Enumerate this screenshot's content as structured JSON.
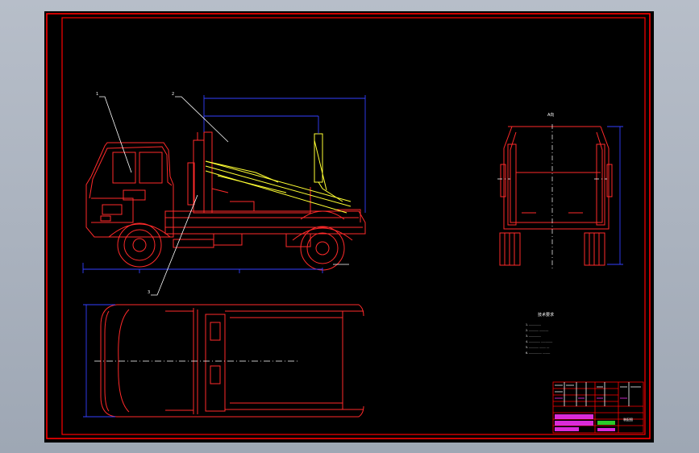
{
  "colors": {
    "background": "#000000",
    "frame": "#ff0000",
    "body_lines": "#ff2a2a",
    "dimension_lines": "#3340ff",
    "arm_lines": "#ffff33",
    "leaders": "#ffffff",
    "table_magenta": "#ff33ff",
    "table_green": "#33ff33"
  },
  "views": {
    "side_view": "side-elevation",
    "rear_view": "rear-elevation",
    "top_view": "plan-view"
  },
  "rear_view": {
    "title": "A向"
  },
  "balloons": [
    "1",
    "2",
    "3"
  ],
  "notes": {
    "heading": "技术要求",
    "lines": [
      "1. ...............",
      "2. ............ ...........",
      "3. ...............",
      "4. ..............  ..............",
      "5. ............  ........  ...",
      "6. ................  ........."
    ]
  },
  "title_block": {
    "drawing_name": "装配图"
  }
}
